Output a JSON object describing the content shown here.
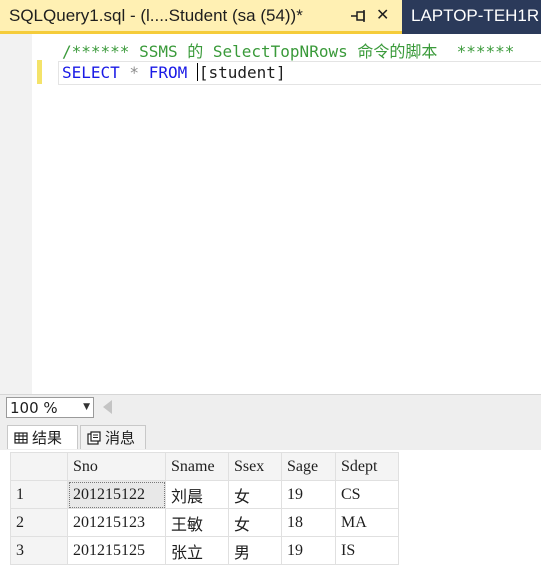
{
  "tabs": {
    "active_title": "SQLQuery1.sql - (l....Student (sa (54))*",
    "pin_icon": "pin-icon",
    "close_glyph": "✕",
    "inactive_title": "LAPTOP-TEH1R"
  },
  "editor": {
    "comment_line": "/****** SSMS 的 SelectTopNRows 命令的脚本  ******",
    "select_kw": "SELECT",
    "star": " * ",
    "from_kw": "FROM",
    "space": " ",
    "table_ref": "[student]"
  },
  "zoom": {
    "value": "100 %"
  },
  "results_tabs": [
    {
      "label": "结果",
      "icon": "grid-icon"
    },
    {
      "label": "消息",
      "icon": "messages-icon"
    }
  ],
  "grid": {
    "columns": [
      "Sno",
      "Sname",
      "Ssex",
      "Sage",
      "Sdept"
    ],
    "rows": [
      {
        "num": "1",
        "cells": [
          "201215122",
          "刘晨",
          "女",
          "19",
          "CS"
        ]
      },
      {
        "num": "2",
        "cells": [
          "201215123",
          "王敏",
          "女",
          "18",
          "MA"
        ]
      },
      {
        "num": "3",
        "cells": [
          "201215125",
          "张立",
          "男",
          "19",
          "IS"
        ]
      }
    ]
  },
  "colors": {
    "tab_active_bg": "#fff0b3",
    "tab_strip_bg": "#2b3a5a",
    "keyword": "#1a1ae6",
    "comment": "#3a9a3a"
  }
}
